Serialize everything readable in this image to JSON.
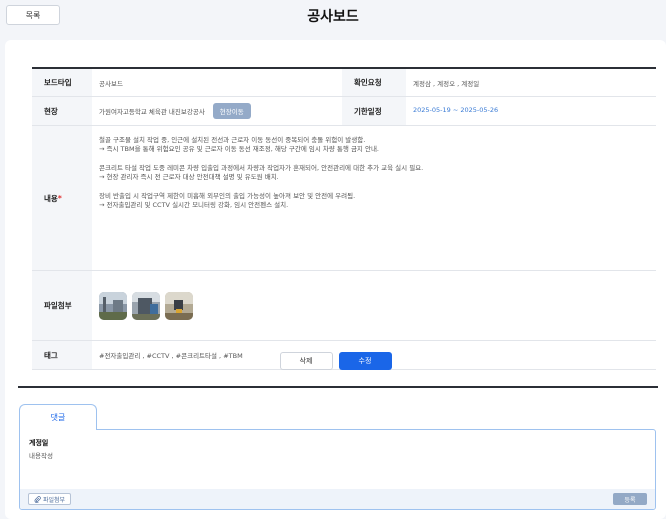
{
  "header": {
    "list_label": "목록",
    "title": "공사보드"
  },
  "detail": {
    "board_type_label": "보드타입",
    "board_type_value": "공사보드",
    "confirm_label": "확인요청",
    "confirm_value": "계정삼 , 계정오 , 계정일",
    "site_label": "현장",
    "site_value": "가원여자고등학교 체육관 내진보강공사",
    "move_label": "현장이동",
    "deadline_label": "기한일정",
    "deadline_value": "2025-05-19 ~ 2025-05-26",
    "content_label": "내용",
    "content_lines": [
      "철골 구조물 설치 작업 중, 인근에 설치된 전선과 근로자 이동 동선이 중복되어 충돌 위험이 발생함.",
      "→ 즉시 TBM을 통해 위험요인 공유 및 근로자 이동 동선 재조정, 해당 구간에 임시 차량 통행 금지 안내.",
      "",
      "콘크리트 타설 작업 도중 레미콘 차량 입출입 과정에서 차량과 작업자가 혼재되어, 안전관리에 대한 추가 교육 실시 필요.",
      "→ 현장 관리자 즉시 전 근로자 대상 안전대책 설명 및 유도원 배치.",
      "",
      "장비 반출입 시 작업구역 제한이 미흡해 외부인의 출입 가능성이 높아져 보안 및 안전에 우려됨.",
      "→ 전자출입관리 및 CCTV 실시간 모니터링 강화, 임시 안전펜스 설치."
    ],
    "files_label": "파일첨부",
    "tags_label": "태그",
    "tags_value": "#전자출입관리 , #CCTV , #콘크리트타설 , #TBM"
  },
  "actions": {
    "delete_label": "삭제",
    "edit_label": "수정"
  },
  "comments": {
    "tab_label": "댓글",
    "author": "계정일",
    "text": "내용작성",
    "attach_label": "파일첨부",
    "submit_label": "등록"
  },
  "colors": {
    "accent": "#1a66e8",
    "required": "#e03131",
    "move_button": "#94aac8"
  }
}
